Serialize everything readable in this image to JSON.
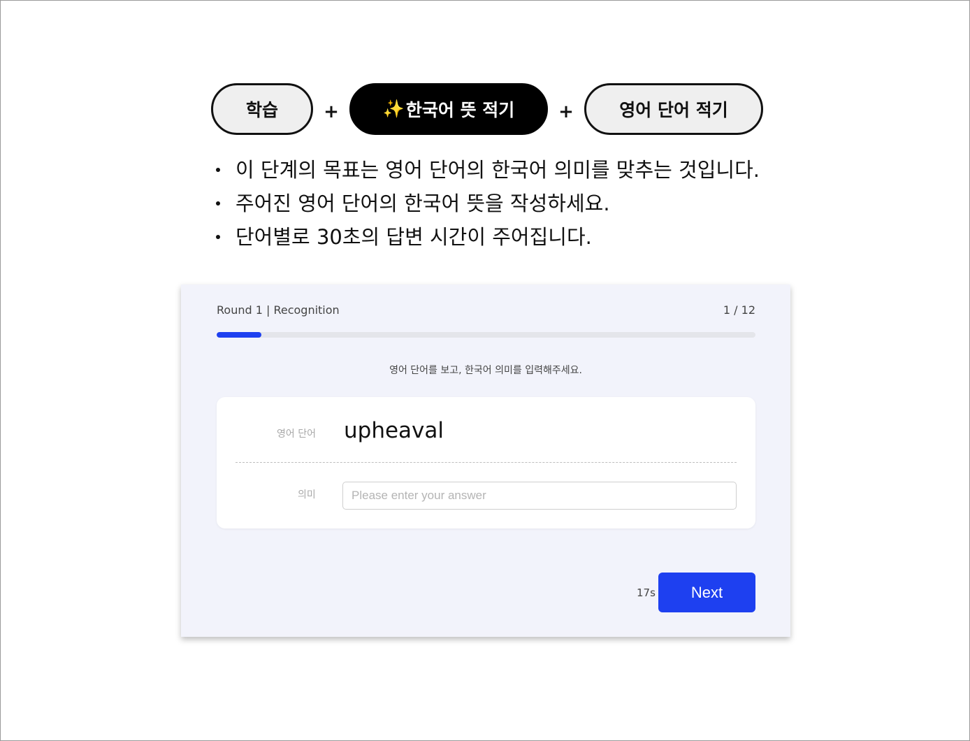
{
  "steps": {
    "step1": "학습",
    "step2_sparkle": "✨",
    "step2": "한국어 뜻 적기",
    "step3": "영어 단어 적기",
    "separator": "+"
  },
  "instructions": [
    "이 단계의 목표는 영어 단어의 한국어 의미를 맞추는 것입니다.",
    "주어진 영어 단어의 한국어 뜻을 작성하세요.",
    "단어별로 30초의 답변 시간이 주어집니다."
  ],
  "quiz": {
    "round_label": "Round 1 | Recognition",
    "counter": "1 / 12",
    "progress_fraction": 0.083,
    "prompt": "영어 단어를 보고, 한국어 의미를 입력해주세요.",
    "word_label": "영어 단어",
    "word": "upheaval",
    "meaning_label": "의미",
    "answer_placeholder": "Please enter your answer",
    "answer_value": "",
    "timer": "17s",
    "next_label": "Next"
  },
  "colors": {
    "accent": "#1e40f0",
    "card_background": "#f2f3fb",
    "active_step": "#000000",
    "inactive_step": "#efefef"
  }
}
